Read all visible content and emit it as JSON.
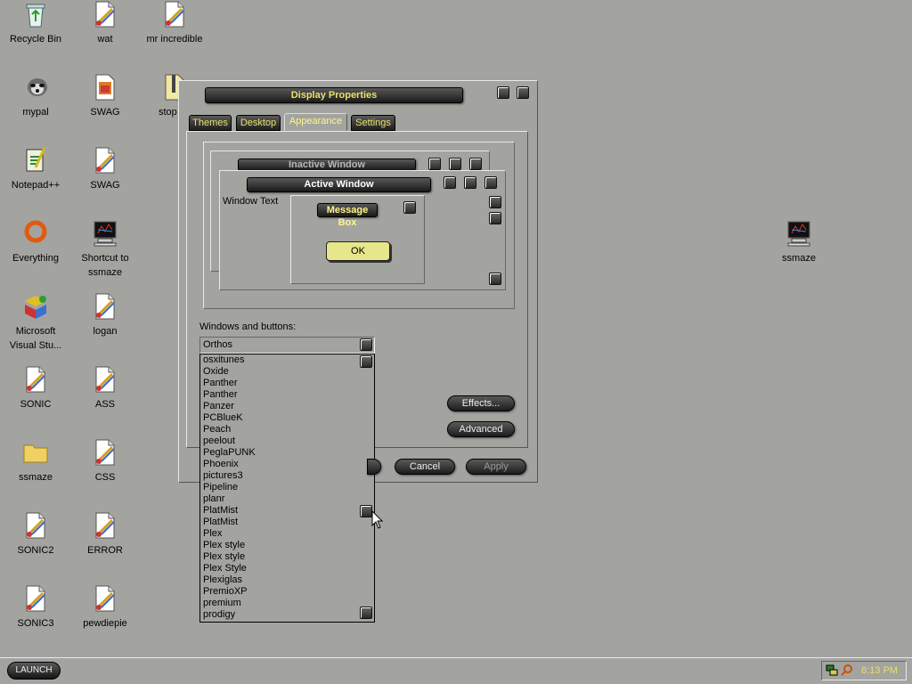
{
  "desktop": {
    "icons": [
      {
        "label": "Recycle Bin",
        "type": "recycle"
      },
      {
        "label": "wat",
        "type": "paint"
      },
      {
        "label": "mr incredible",
        "type": "paint"
      },
      {
        "label": "mypal",
        "type": "raccoon"
      },
      {
        "label": "SWAG",
        "type": "swag"
      },
      {
        "label": "stop be",
        "type": "zip"
      },
      {
        "label": "Notepad++",
        "type": "notepad"
      },
      {
        "label": "SWAG",
        "type": "paint"
      },
      {
        "label": "Everything",
        "type": "everything"
      },
      {
        "label": "Shortcut to",
        "label2": "ssmaze",
        "type": "monitor"
      },
      {
        "label": "Microsoft",
        "label2": "Visual Stu...",
        "type": "vs"
      },
      {
        "label": "logan",
        "type": "paint"
      },
      {
        "label": "SONIC",
        "type": "paint"
      },
      {
        "label": "ASS",
        "type": "paint"
      },
      {
        "label": "ssmaze",
        "type": "folder"
      },
      {
        "label": "CSS",
        "type": "paint"
      },
      {
        "label": "SONIC2",
        "type": "paint"
      },
      {
        "label": "ERROR",
        "type": "paint"
      },
      {
        "label": "SONIC3",
        "type": "paint"
      },
      {
        "label": "pewdiepie",
        "type": "paint"
      },
      {
        "label": "ssmaze",
        "type": "monitor"
      }
    ]
  },
  "dialog": {
    "title": "Display Properties",
    "tabs": [
      "Themes",
      "Desktop",
      "Appearance",
      "Settings"
    ],
    "active_tab": "Appearance",
    "preview": {
      "inactive_title": "Inactive Window",
      "active_title": "Active Window",
      "window_text": "Window Text",
      "message_box_title": "Message Box",
      "ok_label": "OK"
    },
    "windows_buttons_label": "Windows and buttons:",
    "selected_style": "Orthos",
    "style_options": [
      "osxitunes",
      "Oxide",
      "Panther",
      "Panther",
      "Panzer",
      "PCBlueK",
      "Peach",
      "peelout",
      "PeglaPUNK",
      "Phoenix",
      "pictures3",
      "Pipeline",
      "planr",
      "PlatMist",
      "PlatMist",
      "Plex",
      "Plex style",
      "Plex style",
      "Plex Style",
      "Plexiglas",
      "PremioXP",
      "premium",
      "prodigy"
    ],
    "effects_label": "Effects...",
    "advanced_label": "Advanced",
    "cancel_label": "Cancel",
    "apply_label": "Apply"
  },
  "taskbar": {
    "start_label": "LAUNCH",
    "clock": "8:13 PM"
  },
  "colors": {
    "desktop_bg": "#a3a3a0",
    "title_text": "#e8e06a",
    "ok_button": "#e6e68a"
  }
}
